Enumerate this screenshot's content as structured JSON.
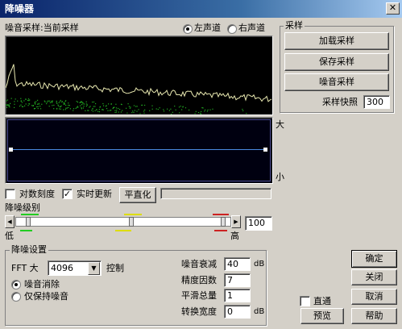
{
  "window": {
    "title": "降噪器"
  },
  "spectrum": {
    "label": "噪音采样:当前采样",
    "channels": [
      {
        "label": "左声道",
        "selected": true
      },
      {
        "label": "右声道",
        "selected": false
      }
    ],
    "background_color": "#000000",
    "curve_color": "#e8e8b0",
    "dots_color": "#22aa22"
  },
  "curve_panel": {
    "label_high": "大",
    "label_low": "小",
    "line_color": "#4a88e0",
    "background_color": "#000010"
  },
  "options": {
    "log_scale_label": "对数刻度",
    "log_scale_checked": false,
    "realtime_label": "实时更新",
    "realtime_checked": true,
    "flatten_button": "平直化"
  },
  "noise_level": {
    "label": "降噪级别",
    "low_label": "低",
    "high_label": "高",
    "value": "100",
    "marker_colors": [
      "#22cc22",
      "#dddd00",
      "#cc2222"
    ]
  },
  "sampling": {
    "group_title": "采样",
    "load_button": "加载采样",
    "save_button": "保存采样",
    "noise_button": "噪音采样",
    "snapshot_label": "采样快照",
    "snapshot_value": "300"
  },
  "settings": {
    "group_title": "降噪设置",
    "fft_label": "FFT 大",
    "fft_value": "4096",
    "control_label": "控制",
    "modes": [
      {
        "label": "噪音消除",
        "selected": true
      },
      {
        "label": "仅保持噪音",
        "selected": false
      }
    ],
    "params": [
      {
        "label": "噪音衰减",
        "value": "40",
        "unit": "dB"
      },
      {
        "label": "精度因数",
        "value": "7",
        "unit": ""
      },
      {
        "label": "平滑总量",
        "value": "1",
        "unit": ""
      },
      {
        "label": "转换宽度",
        "value": "0",
        "unit": "dB"
      }
    ]
  },
  "bottom": {
    "direct_label": "直通",
    "direct_checked": false,
    "preview_button": "预览",
    "ok_button": "确定",
    "close_button": "关闭",
    "cancel_button": "取消",
    "help_button": "帮助"
  }
}
